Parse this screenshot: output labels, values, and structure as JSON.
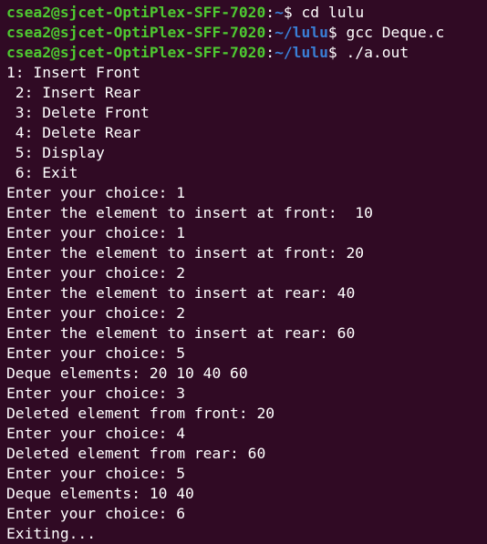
{
  "colors": {
    "background": "#300a24",
    "text": "#ffffff",
    "prompt_user": "#4ec931",
    "prompt_path": "#3a7fd6"
  },
  "prompts": [
    {
      "user_host": "csea2@sjcet-OptiPlex-SFF-7020",
      "colon": ":",
      "path": "~",
      "dollar": "$ ",
      "command": "cd lulu"
    },
    {
      "user_host": "csea2@sjcet-OptiPlex-SFF-7020",
      "colon": ":",
      "path": "~/lulu",
      "dollar": "$ ",
      "command": "gcc Deque.c"
    },
    {
      "user_host": "csea2@sjcet-OptiPlex-SFF-7020",
      "colon": ":",
      "path": "~/lulu",
      "dollar": "$ ",
      "command": "./a.out"
    }
  ],
  "output": [
    "1: Insert Front",
    " 2: Insert Rear",
    " 3: Delete Front",
    " 4: Delete Rear",
    " 5: Display",
    " 6: Exit",
    "Enter your choice: 1",
    "Enter the element to insert at front:  10",
    "Enter your choice: 1",
    "Enter the element to insert at front: 20",
    "Enter your choice: 2",
    "Enter the element to insert at rear: 40",
    "Enter your choice: 2",
    "Enter the element to insert at rear: 60",
    "Enter your choice: 5",
    "Deque elements: 20 10 40 60",
    "Enter your choice: 3",
    "Deleted element from front: 20",
    "Enter your choice: 4",
    "Deleted element from rear: 60",
    "Enter your choice: 5",
    "Deque elements: 10 40",
    "Enter your choice: 6",
    "Exiting..."
  ]
}
